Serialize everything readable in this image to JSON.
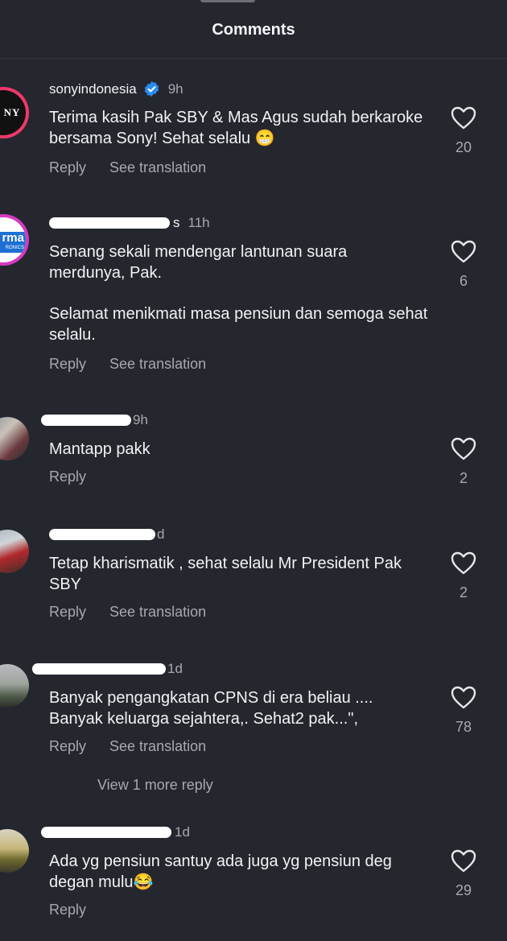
{
  "header": {
    "title": "Comments"
  },
  "comments": [
    {
      "username": "sonyindonesia",
      "time": "9h",
      "text": "Terima kasih Pak SBY & Mas Agus sudah berkaroke bersama Sony! Sehat selalu 😁",
      "reply_label": "Reply",
      "translation_label": "See translation",
      "likes": "20",
      "avatar_text": "NY"
    },
    {
      "username_suffix": "s",
      "time": "11h",
      "text": "Senang sekali mendengar lantunan suara merdunya, Pak.",
      "text2": "Selamat menikmati masa pensiun dan semoga sehat selalu.",
      "reply_label": "Reply",
      "translation_label": "See translation",
      "likes": "6",
      "avatar_text": "rma",
      "avatar_subtext": "RONICS"
    },
    {
      "time": "9h",
      "text": "Mantapp pakk",
      "reply_label": "Reply",
      "likes": "2"
    },
    {
      "time": "d",
      "text": "Tetap kharismatik , sehat selalu Mr President Pak SBY",
      "reply_label": "Reply",
      "translation_label": "See translation",
      "likes": "2"
    },
    {
      "time": "1d",
      "text": "Banyak pengangkatan CPNS di era beliau .... Banyak keluarga sejahtera,. Sehat2 pak...\",",
      "reply_label": "Reply",
      "translation_label": "See translation",
      "likes": "78",
      "view_more": "View 1 more reply"
    },
    {
      "time": "1d",
      "text": "Ada yg pensiun santuy ada juga yg pensiun deg degan mulu😂",
      "reply_label": "Reply",
      "likes": "29"
    }
  ],
  "icons": {
    "like": "heart-outline-icon",
    "verified": "verified-badge-icon"
  },
  "colors": {
    "background": "#25272f",
    "secondary_text": "#a7a9ae",
    "verified": "#2a8cf0"
  }
}
